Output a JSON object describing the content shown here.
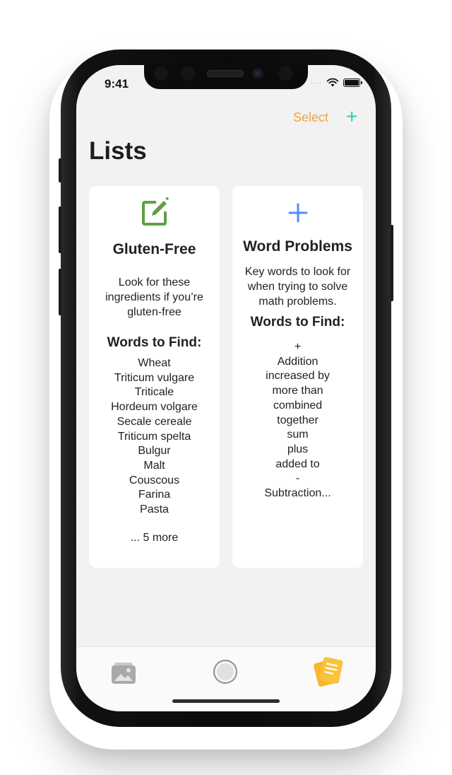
{
  "status_bar": {
    "time": "9:41"
  },
  "nav": {
    "select_label": "Select",
    "add_label": "+"
  },
  "page": {
    "title": "Lists"
  },
  "cards": [
    {
      "icon": "edit-icon",
      "icon_color": "#5fa044",
      "title": "Gluten-Free",
      "description": "Look for these ingredients if you’re gluten-free",
      "words_heading": "Words to Find:",
      "words": [
        "Wheat",
        "Triticum vulgare",
        "Triticale",
        "Hordeum volgare",
        "Secale cereale",
        "Triticum spelta",
        "Bulgur",
        "Malt",
        "Couscous",
        "Farina",
        "Pasta"
      ],
      "more": "... 5 more"
    },
    {
      "icon": "plus-icon",
      "icon_color": "#4f8ef7",
      "title": "Word Problems",
      "description": "Key words to look for when trying to solve math problems.",
      "words_heading": "Words to Find:",
      "words": [
        "+",
        "Addition",
        "increased by",
        "more than",
        "combined",
        "together",
        "sum",
        "plus",
        "added to",
        "-",
        "Subtraction..."
      ]
    }
  ],
  "tabbar": {
    "items": [
      {
        "icon": "photos-icon"
      },
      {
        "icon": "camera-shutter-icon"
      },
      {
        "icon": "lists-icon",
        "selected": true
      }
    ]
  },
  "colors": {
    "accent_orange": "#f2a33a",
    "accent_teal": "#36c8b4",
    "selected_tab": "#f6b730"
  }
}
